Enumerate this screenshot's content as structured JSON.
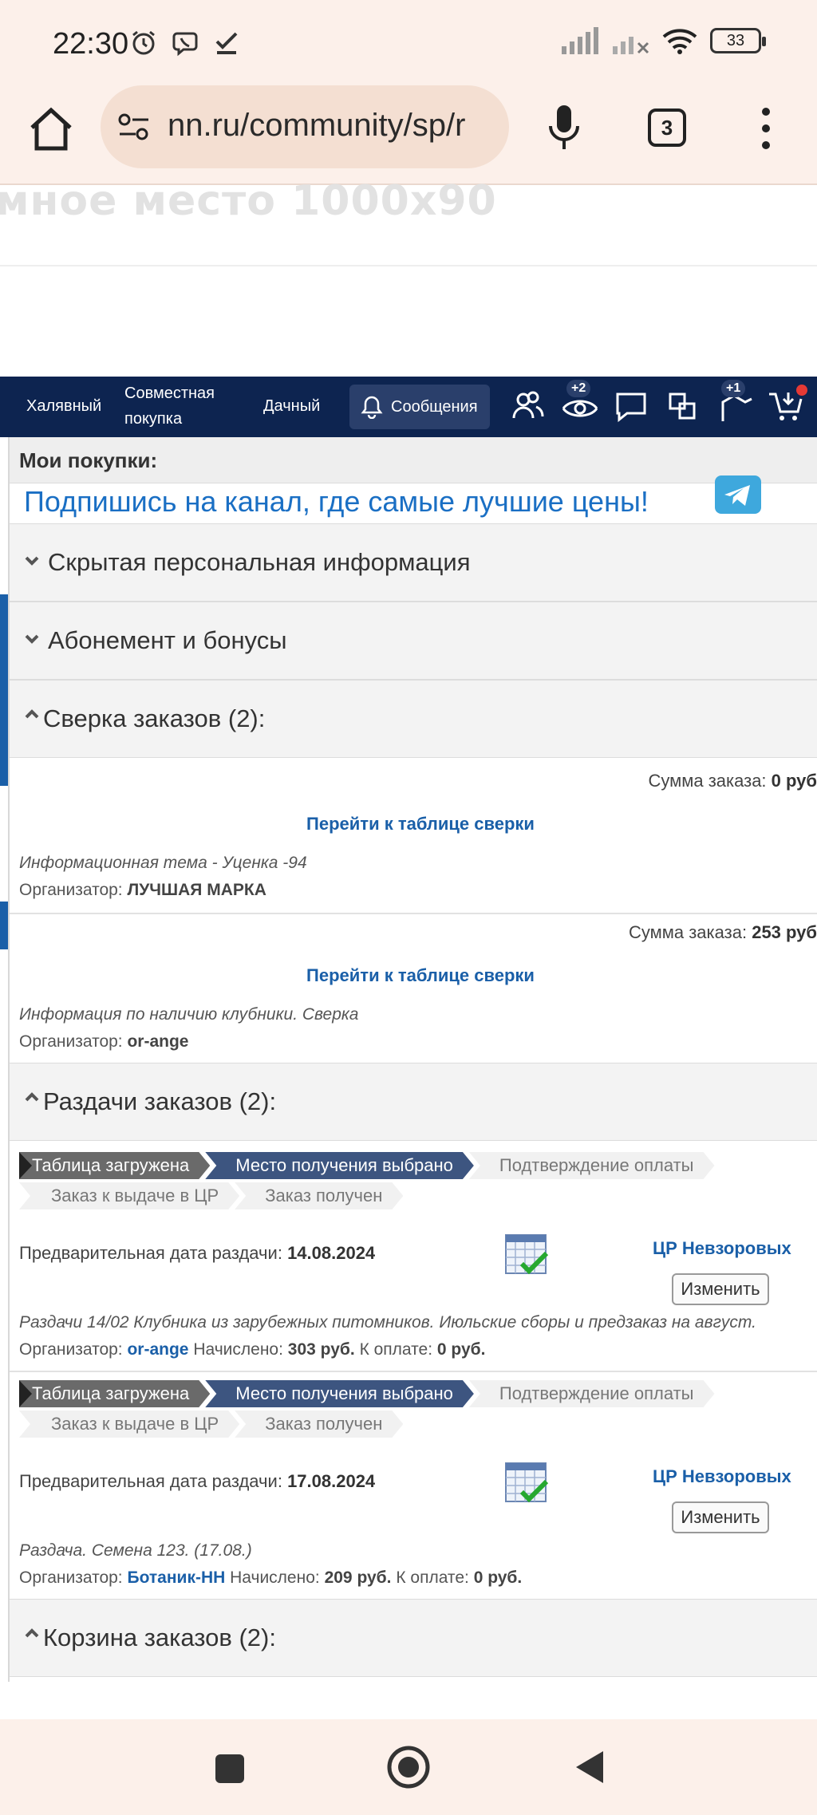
{
  "status_bar": {
    "time": "22:30",
    "battery": "33"
  },
  "browser": {
    "url": "nn.ru/community/sp/r",
    "tab_count": "3"
  },
  "ad": {
    "text": "мное место 1000x90"
  },
  "nav": {
    "items": [
      "Халявный",
      "Совместная",
      "покупка",
      "Дачный"
    ],
    "messages_label": "Сообщения",
    "badge_views": "+2",
    "badge_flag": "+1"
  },
  "panel": {
    "title": "Мои покупки:",
    "promo": "Подпишись на канал, где самые лучшие цены!",
    "sections": {
      "hidden_info": "Скрытая персональная информация",
      "subscription": "Абонемент и бонусы",
      "reconcile": "Сверка заказов (2):",
      "distribution": "Раздачи заказов (2):",
      "cart": "Корзина заказов (2):"
    },
    "reconcile_items": [
      {
        "sum_label": "Сумма заказа:",
        "sum_value": "0 руб",
        "link": "Перейти к таблице сверки",
        "topic": "Информационная тема - Уценка -94",
        "org_label": "Организатор:",
        "org_value": "ЛУЧШАЯ МАРКА"
      },
      {
        "sum_label": "Сумма заказа:",
        "sum_value": "253 руб",
        "link": "Перейти к таблице сверки",
        "topic": "Информация по наличию клубники. Сверка",
        "org_label": "Организатор:",
        "org_value": "or-ange"
      }
    ],
    "steps": [
      "Таблица загружена",
      "Место получения выбрано",
      "Подтверждение оплаты",
      "Заказ к выдаче в ЦР",
      "Заказ получен"
    ],
    "distribution_items": [
      {
        "date_label": "Предварительная дата раздачи:",
        "date_value": "14.08.2024",
        "cr": "ЦР Невзоровых",
        "change": "Изменить",
        "topic": "Раздачи 14/02 Клубника из зарубежных питомников. Июльские сборы и предзаказ на август.",
        "org_label": "Организатор:",
        "org_value": "or-ange",
        "accrued_label": "Начислено:",
        "accrued_value": "303 руб.",
        "pay_label": "К оплате:",
        "pay_value": "0 руб."
      },
      {
        "date_label": "Предварительная дата раздачи:",
        "date_value": "17.08.2024",
        "cr": "ЦР Невзоровых",
        "change": "Изменить",
        "topic": "Раздача. Семена 123. (17.08.)",
        "org_label": "Организатор:",
        "org_value": "Ботаник-НН",
        "accrued_label": "Начислено:",
        "accrued_value": "209 руб.",
        "pay_label": "К оплате:",
        "pay_value": "0 руб."
      }
    ]
  },
  "colors": {
    "nav_bg": "#0d2450",
    "link": "#1a5fa8",
    "promo": "#1a6fc4",
    "step_done": "#3d5580",
    "step_first": "#6a6a6a"
  }
}
